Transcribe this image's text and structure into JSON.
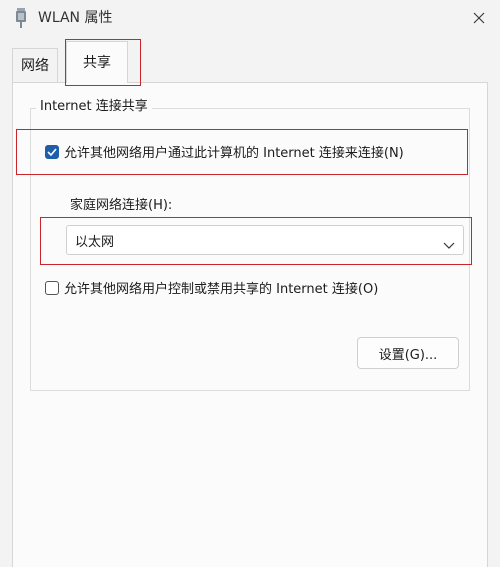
{
  "window": {
    "title": "WLAN 属性",
    "icon": "network-adapter-icon",
    "close_icon": "close-icon"
  },
  "tabs": [
    {
      "label": "网络",
      "selected": false
    },
    {
      "label": "共享",
      "selected": true
    }
  ],
  "sharing": {
    "group_title": "Internet 连接共享",
    "allow_connect": {
      "label": "允许其他网络用户通过此计算机的 Internet 连接来连接(N)",
      "checked": true
    },
    "home_network": {
      "label": "家庭网络连接(H):",
      "value": "以太网"
    },
    "allow_control": {
      "label": "允许其他网络用户控制或禁用共享的 Internet 连接(O)",
      "checked": false
    },
    "settings_button": "设置(G)..."
  },
  "colors": {
    "accent": "#1f5ea8",
    "highlight": "#c9252b",
    "window_bg": "#f3f3f3",
    "panel_bg": "#fbfbfb"
  }
}
